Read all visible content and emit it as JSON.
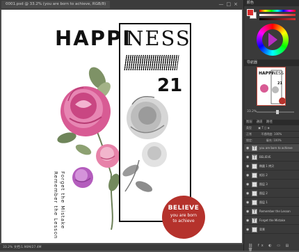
{
  "document": {
    "tab_title": "0001.psd @ 33.2% (you are born to achieve, RGB/8)",
    "window_controls": "—□×"
  },
  "poster": {
    "title_left": "HAPPI",
    "title_right": "NESS",
    "number": "21",
    "vertical_left": "Forget the Mistake",
    "vertical_right": "Remember the Lesson",
    "badge_title": "BELIEVE",
    "badge_sub_1": "you are born",
    "badge_sub_2": "to achieve"
  },
  "status_bar": {
    "text": "33.2%    文档:1.96M/27.4M"
  },
  "colors": {
    "foreground": "#d92e2e",
    "background": "#ffffff",
    "accent": "#b5322c"
  },
  "panels": {
    "color_header": "颜色",
    "navigator_header": "导航器",
    "navigator_zoom": "33.2%",
    "layers_tabs": [
      "图层",
      "通道",
      "路径"
    ],
    "layers_kind": "类型",
    "layers_mode": "正常",
    "layers_opacity": "不透明度: 100%",
    "layers_fill": "填充: 100%",
    "lock_label": "锁定:",
    "layers": [
      {
        "name": "you are born to achieve",
        "type": "T",
        "selected": true
      },
      {
        "name": "BELIEVE",
        "type": "T",
        "selected": false
      },
      {
        "name": "椭圆 1 拷贝",
        "type": "shape",
        "selected": false
      },
      {
        "name": "矩形 2",
        "type": "shape",
        "selected": false
      },
      {
        "name": "图层 3",
        "type": "image",
        "selected": false
      },
      {
        "name": "图层 2",
        "type": "image",
        "selected": false
      },
      {
        "name": "图层 1",
        "type": "image",
        "selected": false
      },
      {
        "name": "Remember the Lesson",
        "type": "T",
        "selected": false
      },
      {
        "name": "Forget the Mistake",
        "type": "T",
        "selected": false
      },
      {
        "name": "背景",
        "type": "bg",
        "selected": false
      }
    ]
  }
}
